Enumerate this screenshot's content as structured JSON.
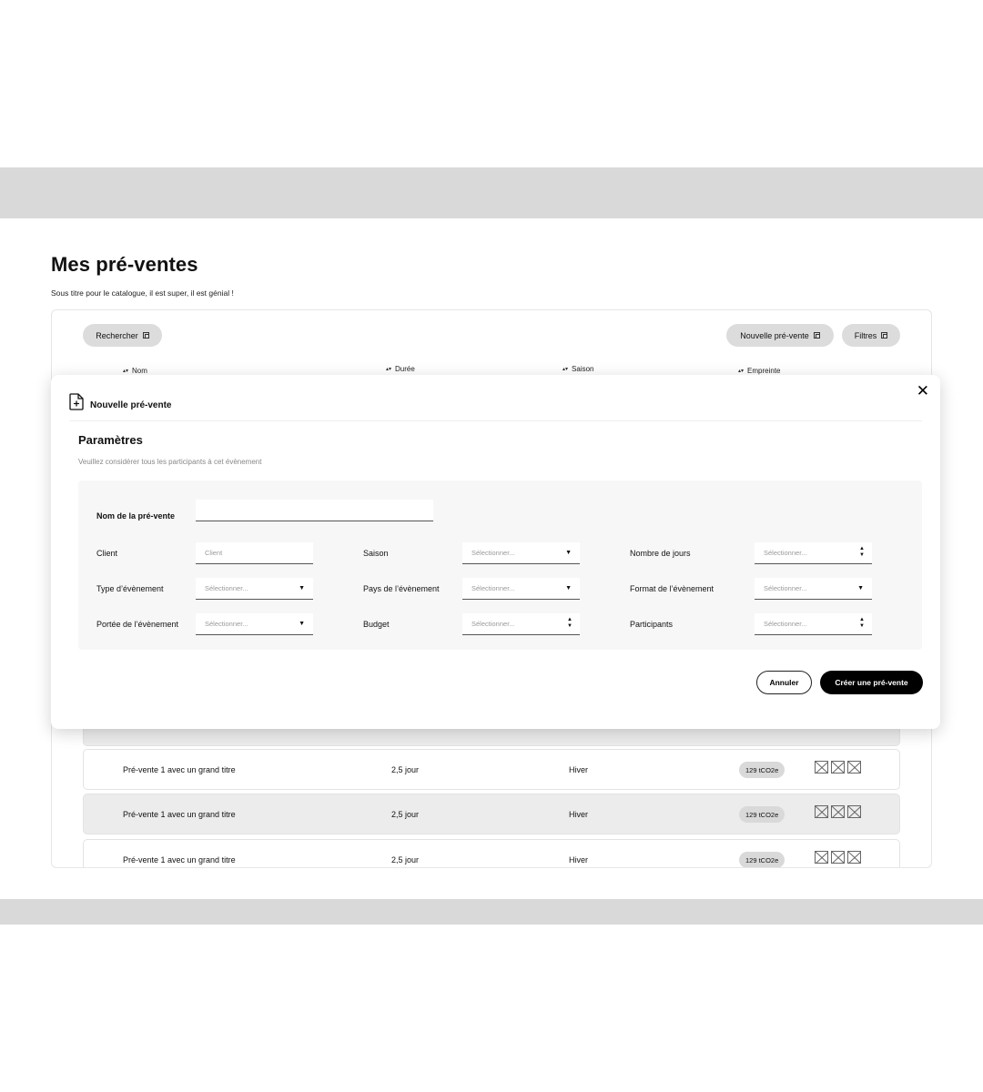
{
  "page": {
    "title": "Mes pré-ventes",
    "subtitle": "Sous titre pour le catalogue, il est super, il est génial !"
  },
  "toolbar": {
    "search_label": "Rechercher",
    "new_presale_label": "Nouvelle pré-vente",
    "filters_label": "Filtres"
  },
  "table": {
    "columns": [
      "Nom",
      "Durée",
      "Saison",
      "Empreinte"
    ],
    "rows": [
      {
        "name": "Pré-vente  1 avec un grand titre",
        "duration": "2,5 jour",
        "season": "Hiver",
        "footprint": "129 tCO2e"
      },
      {
        "name": "Pré-vente  1 avec un grand titre",
        "duration": "2,5 jour",
        "season": "Hiver",
        "footprint": "129 tCO2e"
      },
      {
        "name": "Pré-vente  1 avec un grand titre",
        "duration": "2,5 jour",
        "season": "Hiver",
        "footprint": "129 tCO2e"
      }
    ]
  },
  "modal": {
    "title": "Nouvelle pré-vente",
    "close_symbol": "✕",
    "section_title": "Paramètres",
    "section_hint": "Veuillez considérer tous les participants à cet évènement",
    "fields": {
      "name_label": "Nom de la pré-vente",
      "name_value": "",
      "client_label": "Client",
      "client_placeholder": "Client",
      "season_label": "Saison",
      "season_placeholder": "Sélectionner...",
      "days_label": "Nombre de jours",
      "days_placeholder": "Sélectionner...",
      "event_type_label": "Type d’évènement",
      "event_type_placeholder": "Sélectionner...",
      "country_label": "Pays de l’évènement",
      "country_placeholder": "Sélectionner...",
      "format_label": "Format de l’évènement",
      "format_placeholder": "Sélectionner...",
      "scope_label": "Portée de l’évènement",
      "scope_placeholder": "Sélectionner...",
      "budget_label": "Budget",
      "budget_placeholder": "Sélectionner...",
      "participants_label": "Participants",
      "participants_placeholder": "Sélectionner..."
    },
    "cancel_label": "Annuler",
    "create_label": "Créer une pré-vente"
  },
  "icons": {
    "sort": "sort-icon",
    "search": "box-icon",
    "document_add": "document-add-icon",
    "close": "close-icon",
    "dropdown": "chevron-down-icon",
    "stepper": "stepper-icon",
    "row_action": "placeholder-image-icon"
  },
  "colors": {
    "band": "#d9d9d9",
    "pill": "#dcdcdc",
    "primary_button": "#000000",
    "panel": "#f7f7f7"
  }
}
